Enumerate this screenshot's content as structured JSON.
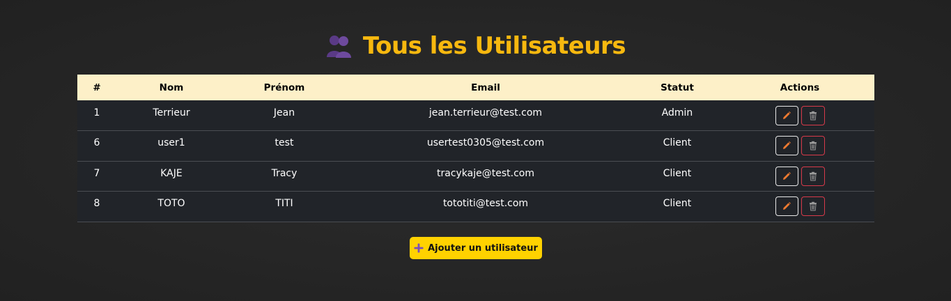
{
  "header": {
    "title": "Tous les Utilisateurs",
    "icon": "users-icon"
  },
  "table": {
    "columns": [
      "#",
      "Nom",
      "Prénom",
      "Email",
      "Statut",
      "Actions"
    ],
    "rows": [
      {
        "id": "1",
        "nom": "Terrieur",
        "prenom": "Jean",
        "email": "jean.terrieur@test.com",
        "statut": "Admin"
      },
      {
        "id": "6",
        "nom": "user1",
        "prenom": "test",
        "email": "usertest0305@test.com",
        "statut": "Client"
      },
      {
        "id": "7",
        "nom": "KAJE",
        "prenom": "Tracy",
        "email": "tracykaje@test.com",
        "statut": "Client"
      },
      {
        "id": "8",
        "nom": "TOTO",
        "prenom": "TITI",
        "email": "tototiti@test.com",
        "statut": "Client"
      }
    ],
    "row_actions": [
      "pencil-icon",
      "trash-icon"
    ]
  },
  "add_button": {
    "label": "Ajouter un utilisateur",
    "icon": "plus-icon"
  },
  "colors": {
    "title": "#f7b80f",
    "header_row": "#fdf0c8",
    "body_row": "#212429",
    "add_button": "#ffd200",
    "edit_border": "#e8e8e8",
    "delete_border": "#d83a4a",
    "pencil": "#f07a30",
    "accent_purple": "#7b4fb8"
  }
}
